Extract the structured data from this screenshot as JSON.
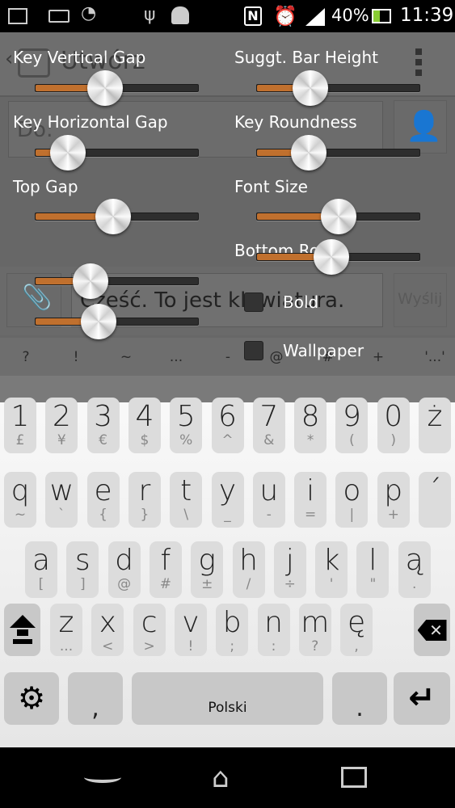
{
  "status_bar": {
    "battery": "40%",
    "time": "11:39"
  },
  "app": {
    "title": "Utwórz",
    "to_placeholder": "Do:",
    "message": "Cześć. To jest klawiatura.",
    "send_label": "Wyślij"
  },
  "suggestions": [
    "?",
    "!",
    "~",
    "...",
    "-",
    "@",
    "#",
    "+",
    "'...'"
  ],
  "settings_overlay": {
    "sliders": [
      {
        "label": "Key Vertical Gap",
        "value": 0.43
      },
      {
        "label": "Suggt. Bar Height",
        "value": 0.33
      },
      {
        "label": "Key Horizontal Gap",
        "value": 0.2
      },
      {
        "label": "Key Roundness",
        "value": 0.32
      },
      {
        "label": "Top Gap",
        "value": 0.48
      },
      {
        "label": "Font Size",
        "value": 0.5
      },
      {
        "label": "Bottom Row",
        "value": 0.46
      },
      {
        "label": "",
        "value": 0.34
      },
      {
        "label": "",
        "value": 0.39
      }
    ],
    "checkboxes": [
      {
        "label": "Bold",
        "checked": false
      },
      {
        "label": "Wallpaper",
        "checked": false
      }
    ]
  },
  "keyboard": {
    "rows": [
      [
        [
          "1",
          "£"
        ],
        [
          "2",
          "¥"
        ],
        [
          "3",
          "€"
        ],
        [
          "4",
          "$"
        ],
        [
          "5",
          "%"
        ],
        [
          "6",
          "^"
        ],
        [
          "7",
          "&"
        ],
        [
          "8",
          "*"
        ],
        [
          "9",
          "("
        ],
        [
          "0",
          ")"
        ],
        [
          "ż",
          ""
        ]
      ],
      [
        [
          "q",
          "~"
        ],
        [
          "w",
          "`"
        ],
        [
          "e",
          "{"
        ],
        [
          "r",
          "}"
        ],
        [
          "t",
          "\\"
        ],
        [
          "y",
          "_"
        ],
        [
          "u",
          "-"
        ],
        [
          "i",
          "="
        ],
        [
          "o",
          "|"
        ],
        [
          "p",
          "+"
        ],
        [
          "´",
          ""
        ]
      ],
      [
        [
          "a",
          "["
        ],
        [
          "s",
          "]"
        ],
        [
          "d",
          "@"
        ],
        [
          "f",
          "#"
        ],
        [
          "g",
          "±"
        ],
        [
          "h",
          "/"
        ],
        [
          "j",
          "÷"
        ],
        [
          "k",
          "'"
        ],
        [
          "l",
          "\""
        ],
        [
          "ą",
          "."
        ]
      ],
      [
        [
          "z",
          "..."
        ],
        [
          "x",
          "<"
        ],
        [
          "c",
          ">"
        ],
        [
          "v",
          "!"
        ],
        [
          "b",
          ";"
        ],
        [
          "n",
          ":"
        ],
        [
          "m",
          "?"
        ],
        [
          "ę",
          ","
        ]
      ]
    ],
    "comma": ",",
    "space_label": "Polski",
    "period": "."
  }
}
